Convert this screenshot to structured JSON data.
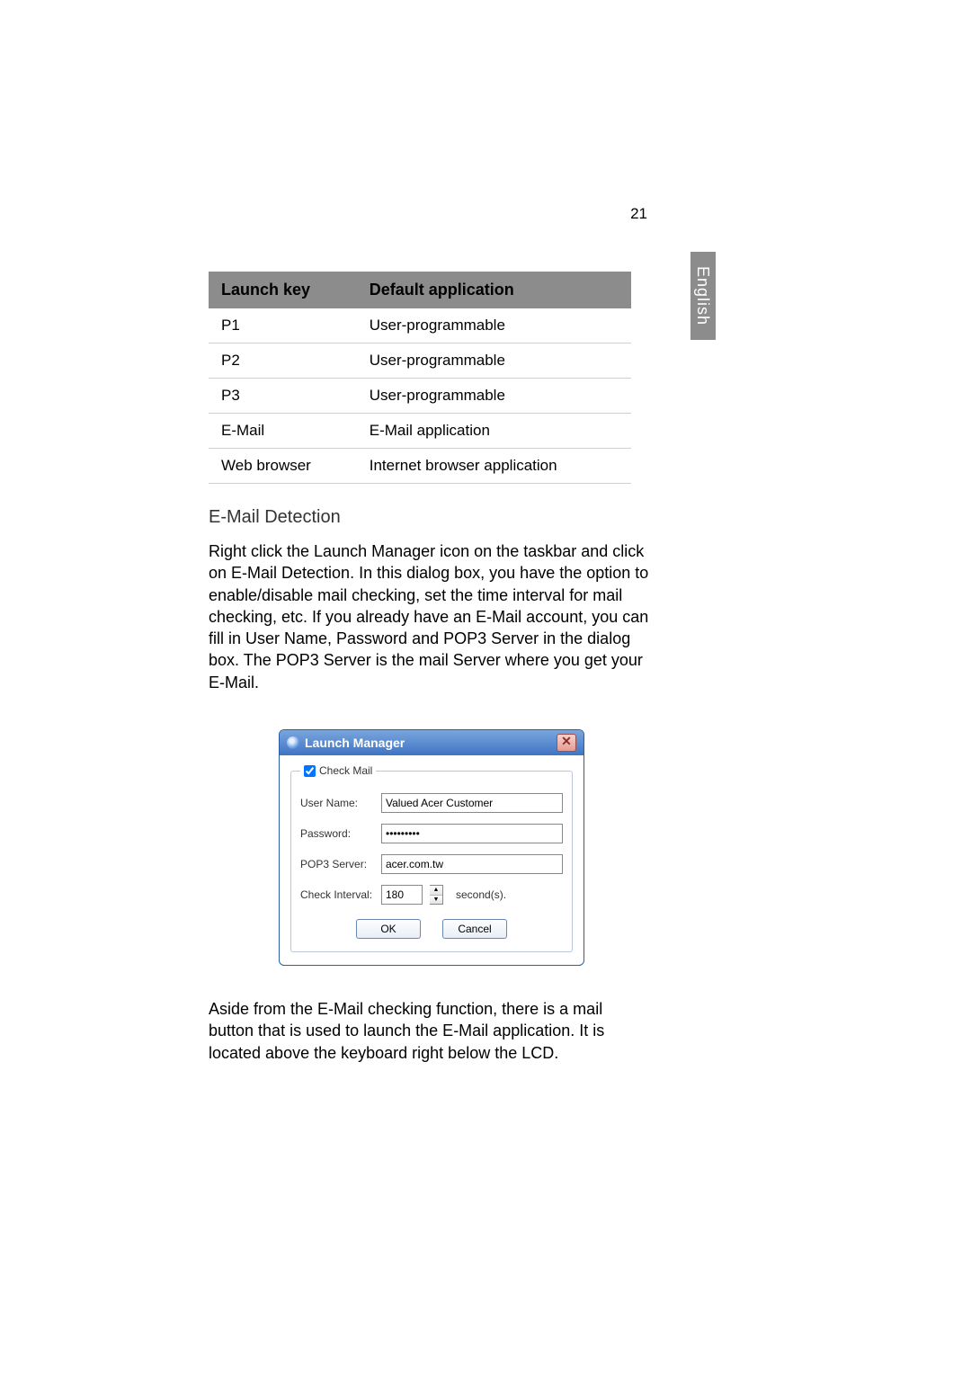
{
  "page_number": "21",
  "language_tab": "English",
  "table": {
    "headers": [
      "Launch key",
      "Default application"
    ],
    "rows": [
      {
        "key": "P1",
        "app": "User-programmable"
      },
      {
        "key": "P2",
        "app": "User-programmable"
      },
      {
        "key": "P3",
        "app": "User-programmable"
      },
      {
        "key": "E-Mail",
        "app": "E-Mail application"
      },
      {
        "key": "Web browser",
        "app": "Internet browser application"
      }
    ]
  },
  "section_heading": "E-Mail Detection",
  "paragraph1": "Right click the Launch Manager icon on the taskbar and click on E-Mail Detection. In this dialog box, you have the option to enable/disable mail checking, set the time interval for mail checking, etc. If you already have an E-Mail account, you can fill in User Name, Password and POP3 Server in the dialog box. The POP3 Server is the mail Server where you get your E-Mail.",
  "dialog": {
    "title": "Launch Manager",
    "check_mail_legend": "Check Mail",
    "check_mail_checked": true,
    "labels": {
      "user_name": "User Name:",
      "password": "Password:",
      "pop3": "POP3 Server:",
      "interval": "Check Interval:",
      "interval_unit": "second(s)."
    },
    "values": {
      "user_name": "Valued Acer Customer",
      "password": "xxxxxxxxx",
      "pop3": "acer.com.tw",
      "interval": "180"
    },
    "buttons": {
      "ok": "OK",
      "cancel": "Cancel"
    }
  },
  "paragraph2": "Aside from the E-Mail checking function, there is a mail button that is used to launch the E-Mail application. It is located above the keyboard right below the LCD."
}
